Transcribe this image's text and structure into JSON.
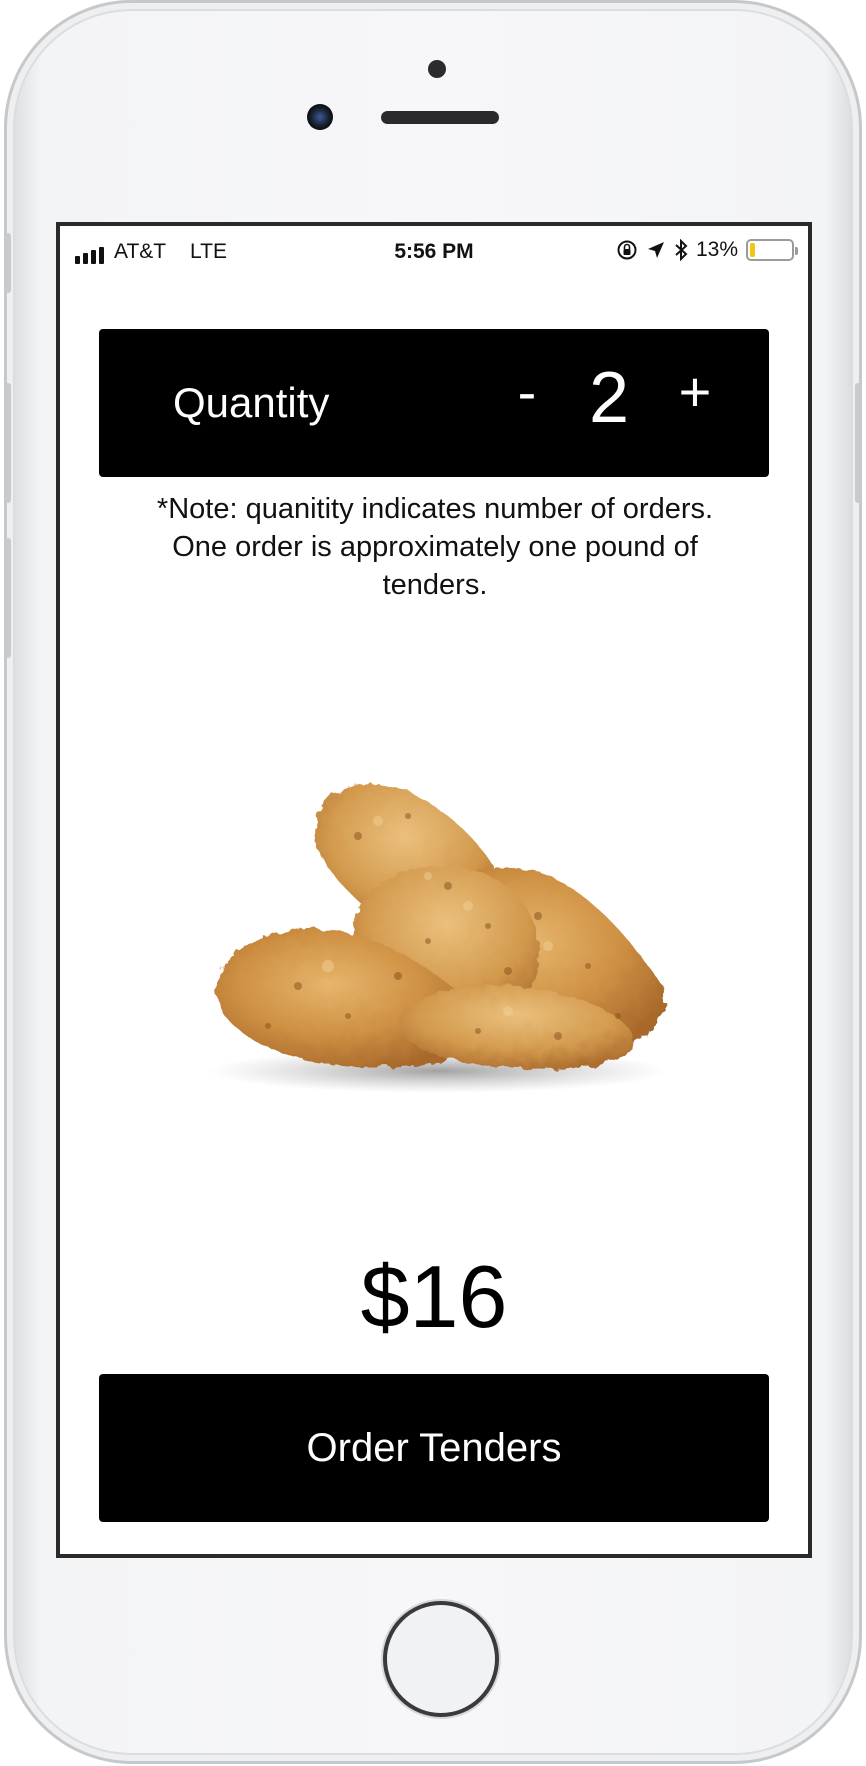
{
  "status_bar": {
    "carrier": "AT&T",
    "network": "LTE",
    "time": "5:56 PM",
    "battery_percent": "13%",
    "battery_level": 0.13,
    "signal_bars": 4
  },
  "quantity": {
    "label": "Quantity",
    "decrement_label": "-",
    "value": "2",
    "increment_label": "+"
  },
  "note": {
    "text": "*Note: quanitity indicates number of orders. One order is approximately one pound of tenders."
  },
  "product": {
    "image_icon": "chicken-tenders-photo"
  },
  "price": {
    "text": "$16"
  },
  "order_button": {
    "label": "Order Tenders"
  },
  "colors": {
    "primary": "#000000",
    "background": "#ffffff",
    "battery": "#f5c515"
  }
}
